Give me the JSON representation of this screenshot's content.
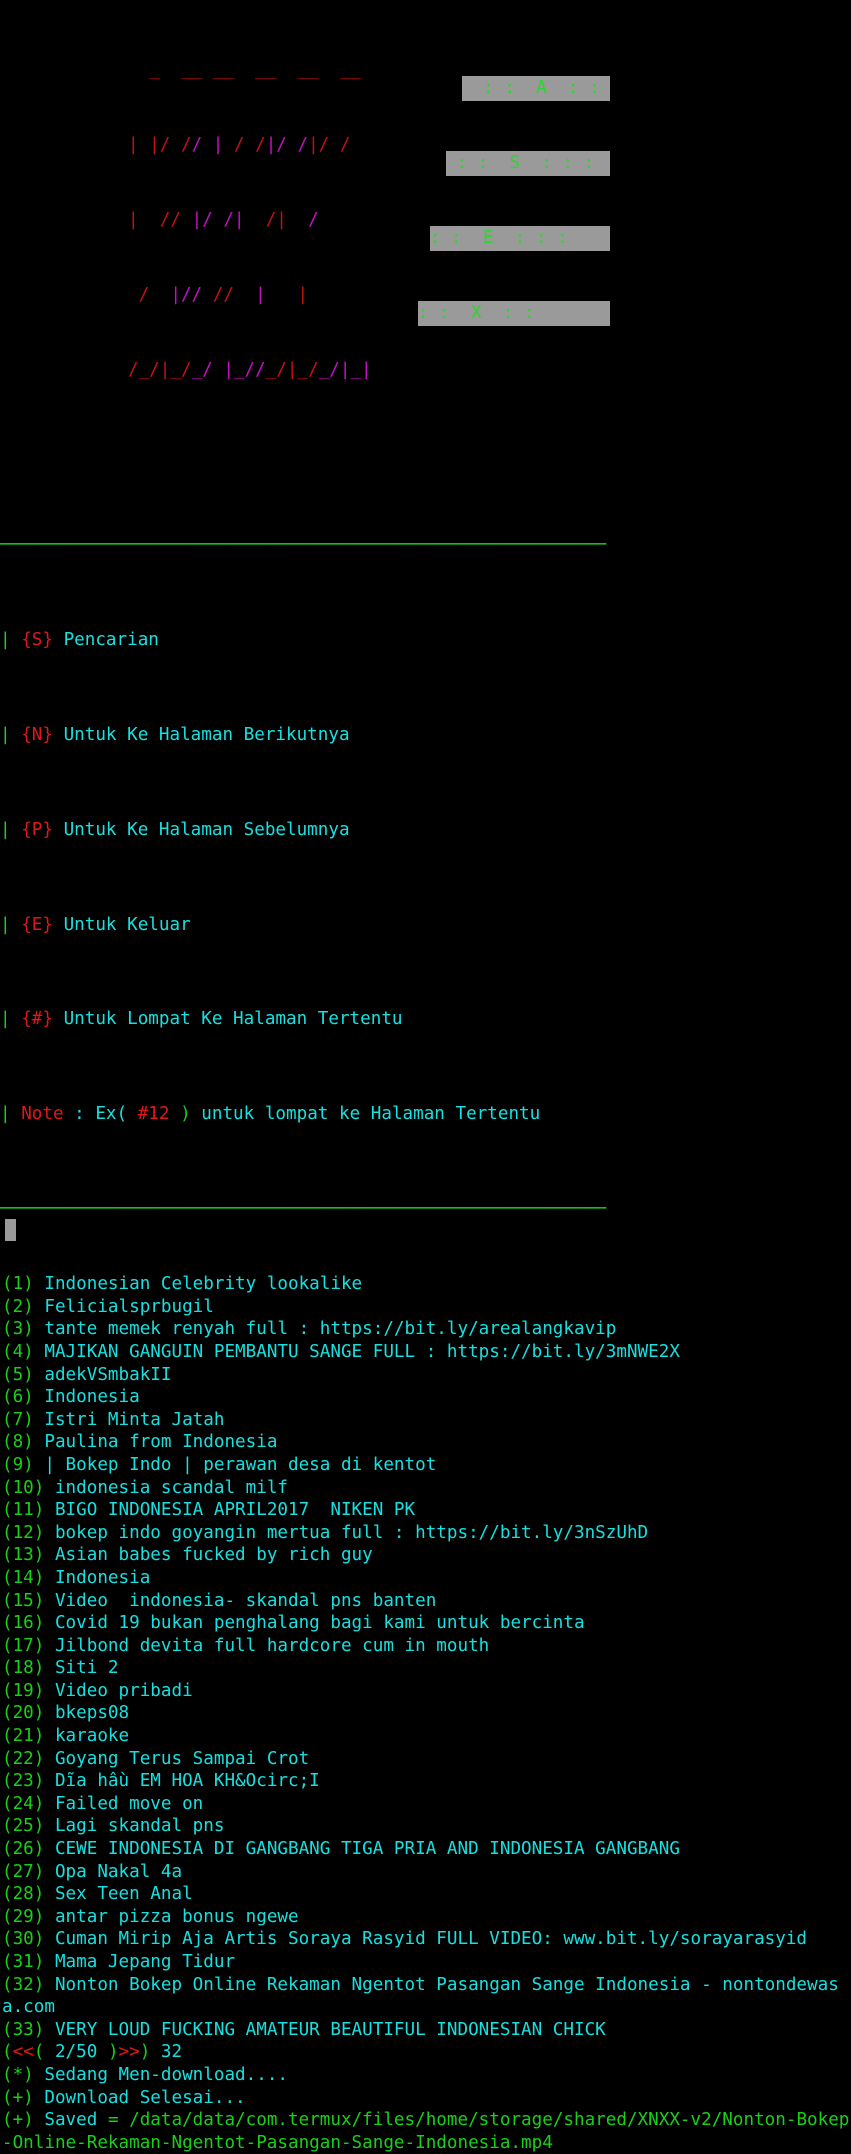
{
  "terminal": {
    "colors": {
      "background": "#000000",
      "cyan": "#18e0e0",
      "green": "#18d018",
      "red": "#e01818",
      "magenta": "#c410c4",
      "dark_red": "#c81010",
      "logo_block_bg": "#9a9a9a",
      "logo_letter": "#2fd32f",
      "cursor": "#9a9a9a"
    }
  },
  "banner": {
    "name": "xnxx-ascii-banner",
    "rows": [
      [
        {
          "t": " _  __ __  __  __  __",
          "c": "red"
        }
      ],
      [
        {
          "t": "| |/ /",
          "c": "red"
        },
        {
          "t": "/ |",
          "c": "mag"
        },
        {
          "t": " / /",
          "c": "red"
        },
        {
          "t": "|/ /",
          "c": "mag"
        },
        {
          "t": "|/ /",
          "c": "red"
        }
      ],
      [
        {
          "t": "|  // ",
          "c": "red"
        },
        {
          "t": "|/ /|",
          "c": "mag"
        },
        {
          "t": "  /| ",
          "c": "red"
        },
        {
          "t": " /",
          "c": "mag"
        }
      ],
      [
        {
          "t": " / ",
          "c": "red"
        },
        {
          "t": " |//",
          "c": "mag"
        },
        {
          "t": " // ",
          "c": "red"
        },
        {
          "t": " | ",
          "c": "mag"
        },
        {
          "t": "  |",
          "c": "red"
        }
      ],
      [
        {
          "t": "/_/|_/",
          "c": "red"
        },
        {
          "t": "_/ |_//",
          "c": "mag"
        },
        {
          "t": "_/|_/",
          "c": "red"
        },
        {
          "t": "_/|_|",
          "c": "mag"
        }
      ]
    ],
    "logo_rows": [
      "  : :  A  : : ",
      " : :  S  : : : ",
      ": :  E  : : : ",
      ": :  X  : : "
    ]
  },
  "menu": {
    "name": "navigation-menu",
    "top_rule": "────────────────────────────────────────────────────────────",
    "bottom_rule": "────────────────────────────────────────────────────────────",
    "side_bar": "|",
    "items": [
      {
        "key": "{S}",
        "label": "Pencarian"
      },
      {
        "key": "{N}",
        "label": "Untuk Ke Halaman Berikutnya"
      },
      {
        "key": "{P}",
        "label": "Untuk Ke Halaman Sebelumnya"
      },
      {
        "key": "{E}",
        "label": "Untuk Keluar"
      },
      {
        "key": "{#}",
        "label": "Untuk Lompat Ke Halaman Tertentu"
      }
    ],
    "note": {
      "label": "Note",
      "sep": " : ",
      "ex_open": "Ex( ",
      "ex_value": "#12",
      "ex_close": " )",
      "rest": " untuk lompat ke Halaman Tertentu"
    }
  },
  "results": {
    "name": "search-results-list",
    "items": [
      {
        "n": "(1)",
        "title": "Indonesian Celebrity lookalike"
      },
      {
        "n": "(2)",
        "title": "Felicialsprbugil"
      },
      {
        "n": "(3)",
        "title": "tante memek renyah full : https://bit.ly/arealangkavip"
      },
      {
        "n": "(4)",
        "title": "MAJIKAN GANGUIN PEMBANTU SANGE FULL : https://bit.ly/3mNWE2X"
      },
      {
        "n": "(5)",
        "title": "adekVSmbakII"
      },
      {
        "n": "(6)",
        "title": "Indonesia"
      },
      {
        "n": "(7)",
        "title": "Istri Minta Jatah"
      },
      {
        "n": "(8)",
        "title": "Paulina from Indonesia"
      },
      {
        "n": "(9)",
        "title": "| Bokep Indo | perawan desa di kentot"
      },
      {
        "n": "(10)",
        "title": "indonesia scandal milf"
      },
      {
        "n": "(11)",
        "title": "BIGO INDONESIA APRIL2017  NIKEN PK"
      },
      {
        "n": "(12)",
        "title": "bokep indo goyangin mertua full : https://bit.ly/3nSzUhD"
      },
      {
        "n": "(13)",
        "title": "Asian babes fucked by rich guy"
      },
      {
        "n": "(14)",
        "title": "Indonesia"
      },
      {
        "n": "(15)",
        "title": "Video  indonesia- skandal pns banten"
      },
      {
        "n": "(16)",
        "title": "Covid 19 bukan penghalang bagi kami untuk bercinta"
      },
      {
        "n": "(17)",
        "title": "Jilbond devita full hardcore cum in mouth"
      },
      {
        "n": "(18)",
        "title": "Siti 2"
      },
      {
        "n": "(19)",
        "title": "Video pribadi"
      },
      {
        "n": "(20)",
        "title": "bkeps08"
      },
      {
        "n": "(21)",
        "title": "karaoke"
      },
      {
        "n": "(22)",
        "title": "Goyang Terus Sampai Crot"
      },
      {
        "n": "(23)",
        "title": "Dĩa hầu EM HOA KH&Ocirc;I"
      },
      {
        "n": "(24)",
        "title": "Failed move on"
      },
      {
        "n": "(25)",
        "title": "Lagi skandal pns"
      },
      {
        "n": "(26)",
        "title": "CEWE INDONESIA DI GANGBANG TIGA PRIA AND INDONESIA GANGBANG"
      },
      {
        "n": "(27)",
        "title": "Opa Nakal 4a"
      },
      {
        "n": "(28)",
        "title": "Sex Teen Anal"
      },
      {
        "n": "(29)",
        "title": "antar pizza bonus ngewe"
      },
      {
        "n": "(30)",
        "title": "Cuman Mirip Aja Artis Soraya Rasyid FULL VIDEO: www.bit.ly/sorayarasyid"
      },
      {
        "n": "(31)",
        "title": "Mama Jepang Tidur"
      },
      {
        "n": "(32)",
        "title": "Nonton Bokep Online Rekaman Ngentot Pasangan Sange Indonesia - nontondewasa.com"
      },
      {
        "n": "(33)",
        "title": "VERY LOUD FUCKING AMATEUR BEAUTIFUL INDONESIAN CHICK"
      }
    ]
  },
  "pagination": {
    "name": "page-indicator",
    "open_paren": "(",
    "prev_arrows": "<<",
    "inner_open": "(",
    "page_label": " 2/50 ",
    "inner_close": ")",
    "next_arrows": ">>",
    "close_paren": ")",
    "count": " 32"
  },
  "status": {
    "name": "download-status",
    "lines": [
      {
        "marker": "(*)",
        "marker_color": "green",
        "text": " Sedang Men-download....",
        "text_color": "cyan"
      },
      {
        "marker": "(+)",
        "marker_color": "green",
        "text": " Download Selesai...",
        "text_color": "cyan"
      }
    ],
    "saved": {
      "marker": "(+)",
      "label": " Saved ",
      "equals": "= ",
      "path": "/data/data/com.termux/files/home/storage/shared/XNXX-v2/Nonton-Bokep-Online-Rekaman-Ngentot-Pasangan-Sange-Indonesia.mp4"
    }
  },
  "prompt": {
    "name": "block-cursor",
    "glyph": "█"
  }
}
